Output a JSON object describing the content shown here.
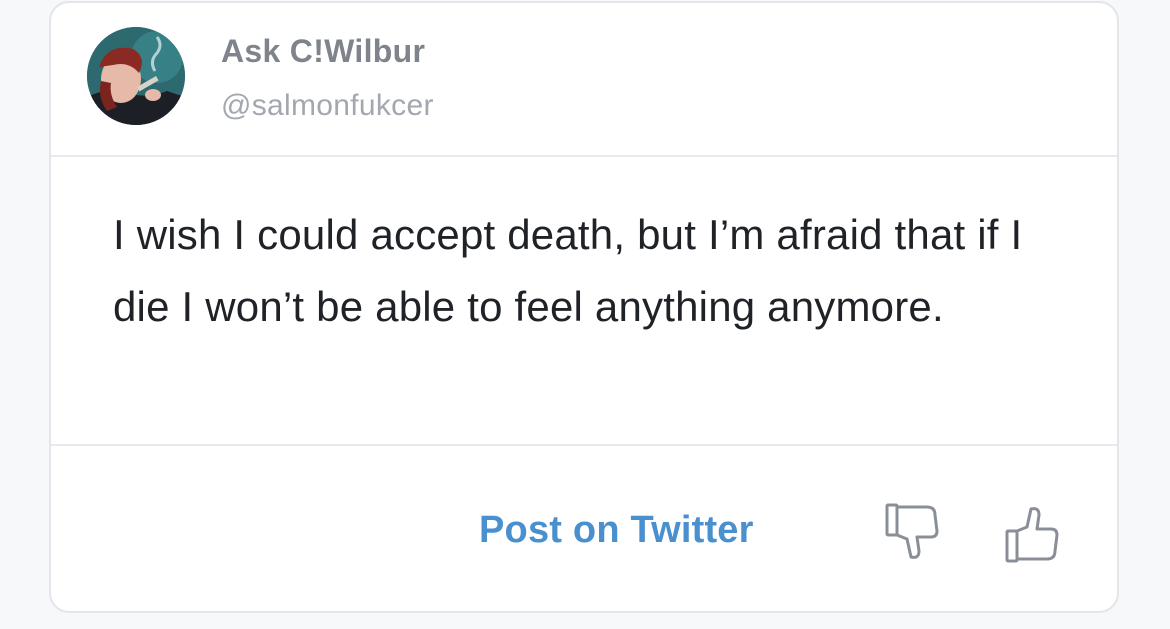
{
  "user": {
    "display_name": "Ask C!Wilbur",
    "handle": "@salmonfukcer"
  },
  "post": {
    "text": "I wish I could accept death, but I’m afraid that if I die I won’t be able to feel anything anymore."
  },
  "actions": {
    "post_label": "Post on Twitter",
    "dislike_icon": "thumbs-down-icon",
    "like_icon": "thumbs-up-icon"
  },
  "colors": {
    "link": "#4a90cf",
    "icon": "#8a8f97",
    "name": "#7e838c",
    "handle": "#a3a8b0",
    "text": "#1f2226"
  }
}
